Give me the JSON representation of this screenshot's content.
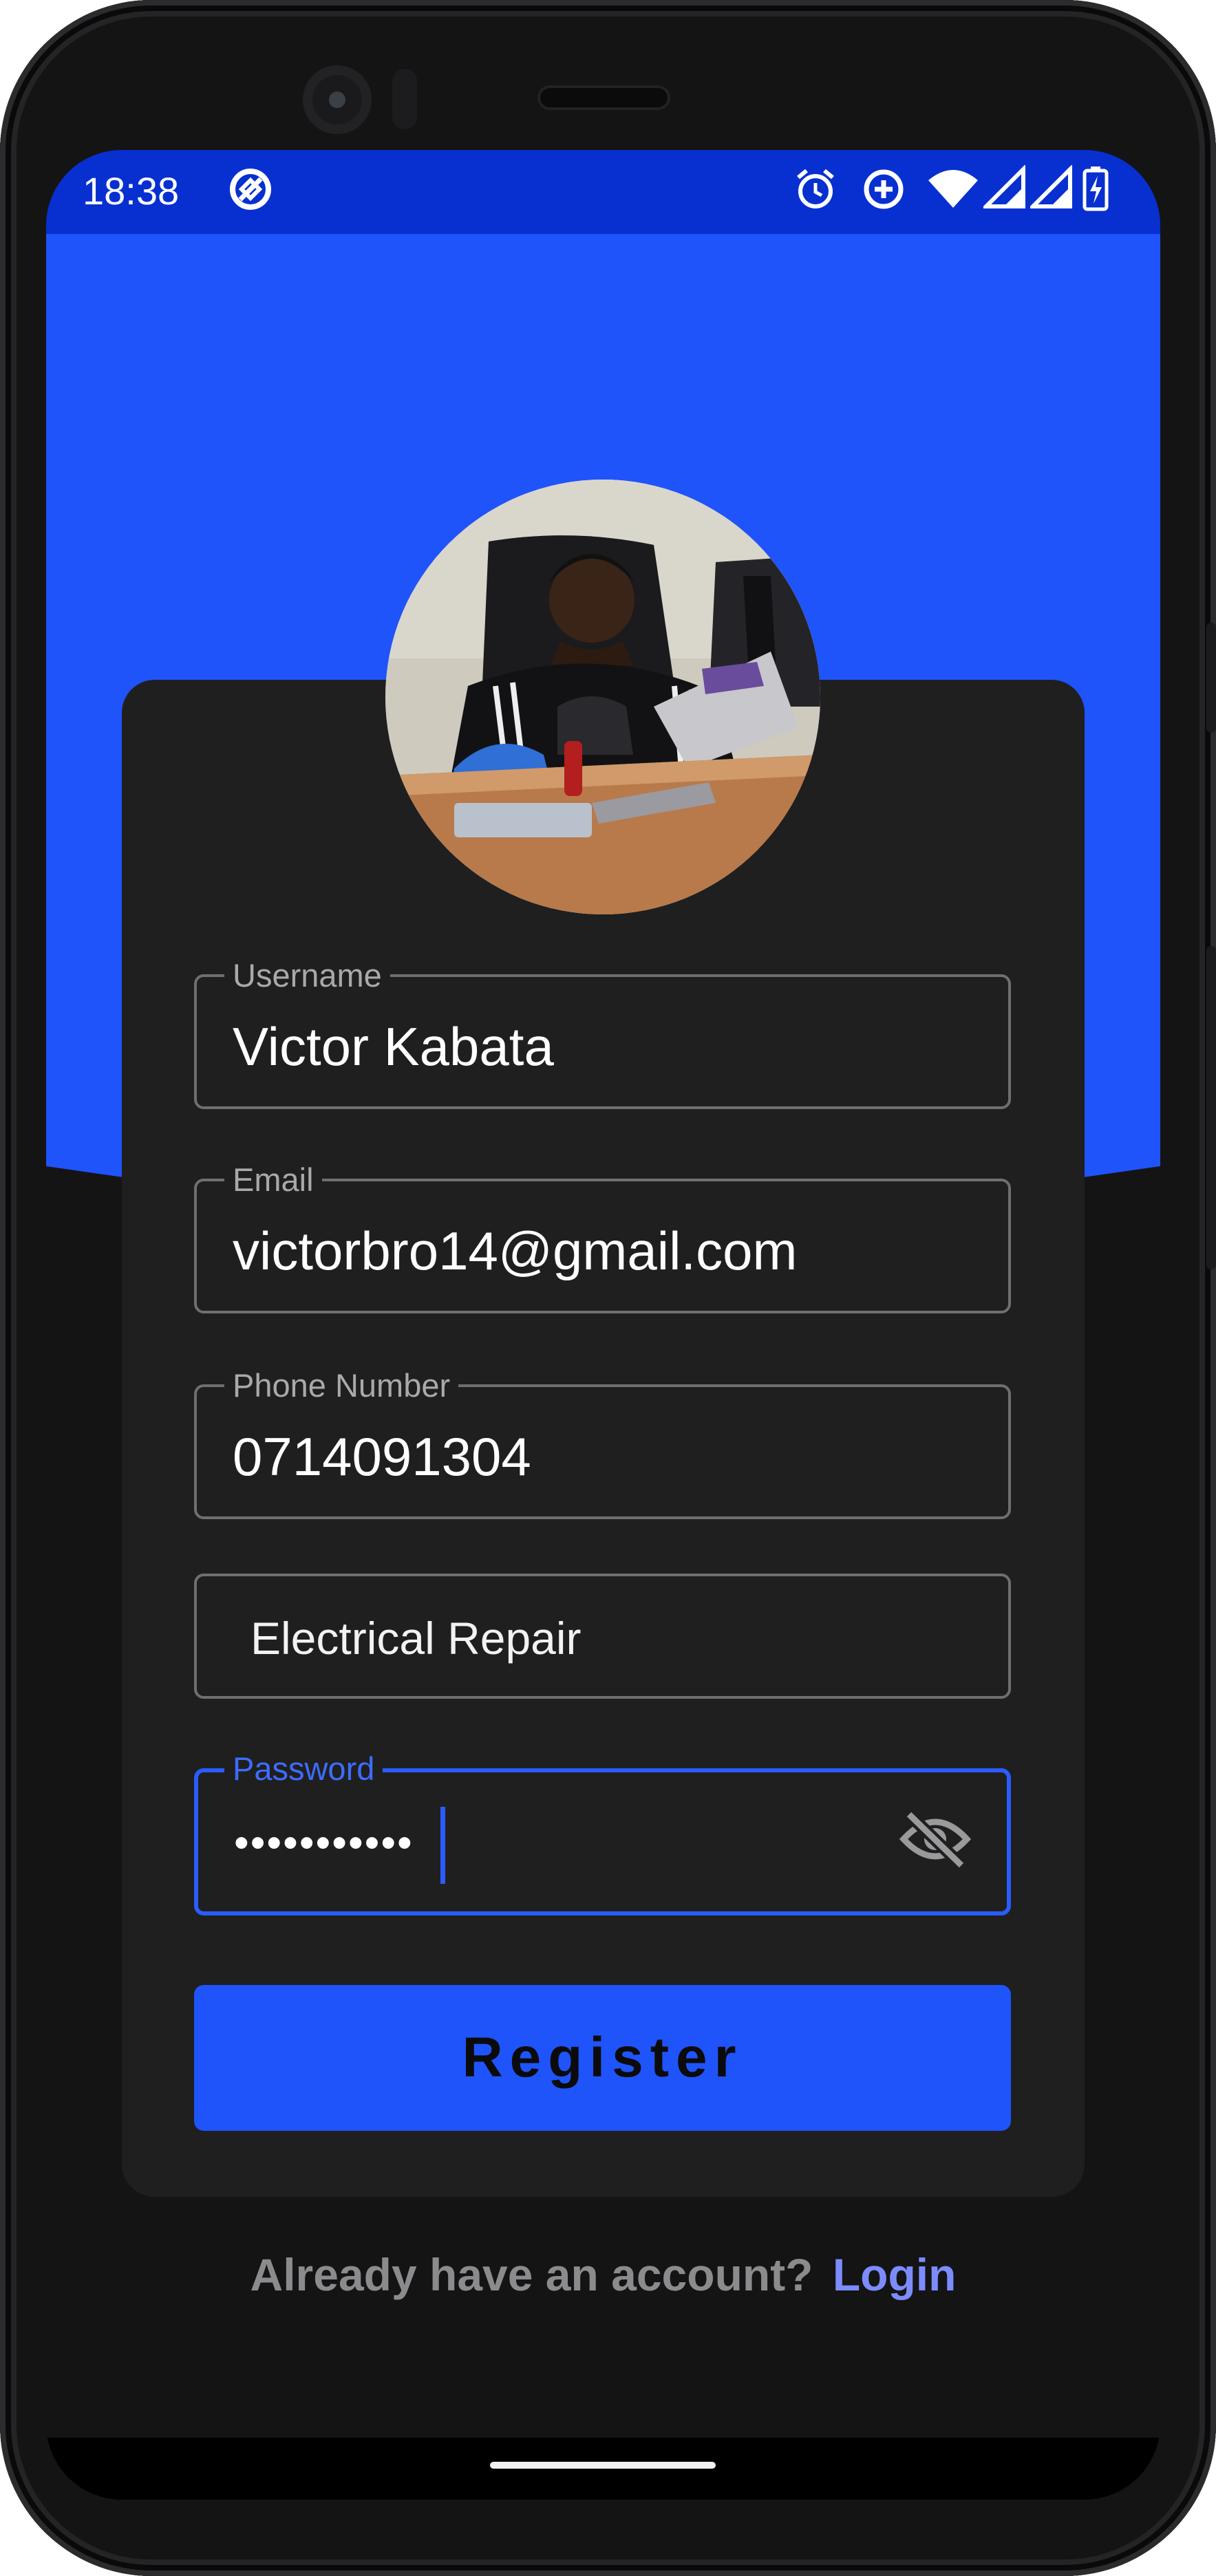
{
  "status_bar": {
    "time": "18:38",
    "icons": [
      "app-notification-icon",
      "alarm-icon",
      "data-saver-icon",
      "wifi-icon",
      "signal-icon",
      "signal-icon",
      "battery-charging-icon"
    ]
  },
  "colors": {
    "accent": "#1f54fa",
    "status_bar": "#0830d0",
    "card": "#1f1f20",
    "background": "#141415",
    "link": "#7c8cff"
  },
  "profile": {
    "avatar": "profile-photo"
  },
  "form": {
    "username": {
      "label": "Username",
      "value": "Victor Kabata"
    },
    "email": {
      "label": "Email",
      "value": "victorbro14@gmail.com"
    },
    "phone": {
      "label": "Phone Number",
      "value": "0714091304"
    },
    "service": {
      "value": "Electrical Repair"
    },
    "password": {
      "label": "Password",
      "value": "•••••••••••",
      "toggle_icon": "visibility-off-icon"
    },
    "register_label": "Register"
  },
  "footer": {
    "question": "Already have an account?",
    "login_label": "Login"
  }
}
